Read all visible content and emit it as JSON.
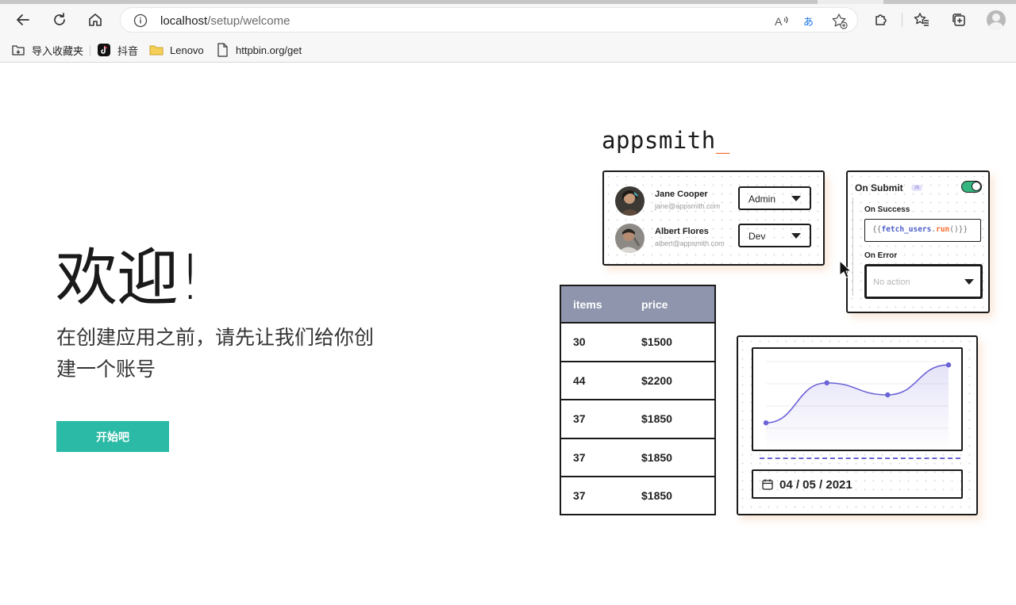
{
  "browser": {
    "url_host": "localhost",
    "url_path": "/setup/welcome",
    "bookmarks": [
      {
        "label": "导入收藏夹",
        "icon": "import-icon"
      },
      {
        "label": "抖音",
        "icon": "tiktok-icon"
      },
      {
        "label": "Lenovo",
        "icon": "folder-icon"
      },
      {
        "label": "httpbin.org/get",
        "icon": "page-icon"
      }
    ]
  },
  "welcome": {
    "heading": "欢迎!",
    "subtitle": "在创建应用之前，请先让我们给你创建一个账号",
    "start_button": "开始吧"
  },
  "illustration": {
    "logo": "appsmith",
    "logo_cursor": "_",
    "users": [
      {
        "name": "Jane Cooper",
        "email": "jane@appsmith.com",
        "role": "Admin"
      },
      {
        "name": "Albert Flores",
        "email": "albert@appsmith.com",
        "role": "Dev"
      }
    ],
    "submit": {
      "title": "On Submit",
      "badge": "JS",
      "on_success": "On Success",
      "code_open": "{{",
      "code_fn": "fetch_users",
      "code_dot": ".",
      "code_method": "run",
      "code_close": "()}}",
      "on_error": "On Error",
      "error_placeholder": "No action"
    },
    "table": {
      "columns": [
        "items",
        "price"
      ],
      "rows": [
        [
          "30",
          "$1500"
        ],
        [
          "44",
          "$2200"
        ],
        [
          "37",
          "$1850"
        ],
        [
          "37",
          "$1850"
        ],
        [
          "37",
          "$1850"
        ]
      ]
    },
    "chart_data": {
      "type": "line",
      "points": [
        0.08,
        0.68,
        0.5,
        0.95
      ],
      "color": "#6b63d6"
    },
    "date": "04 / 05 / 2021"
  }
}
